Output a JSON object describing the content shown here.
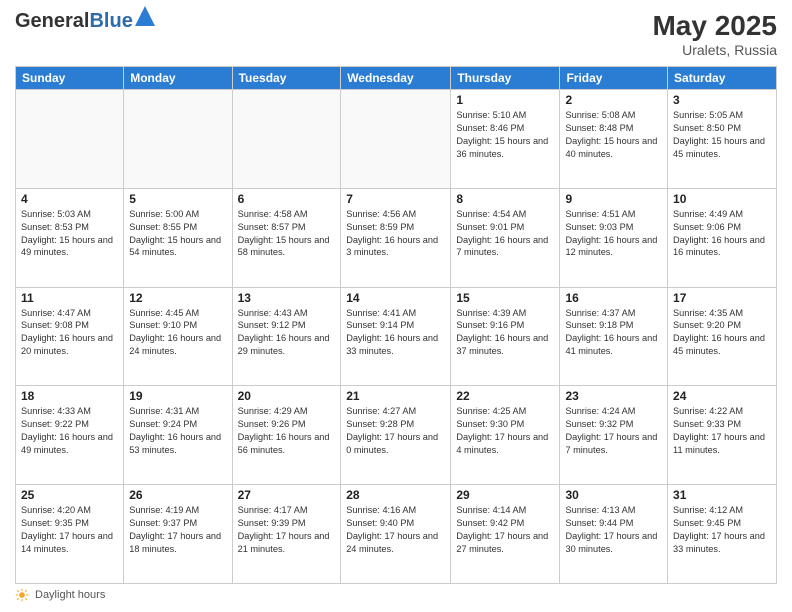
{
  "logo": {
    "general": "General",
    "blue": "Blue"
  },
  "title": {
    "month_year": "May 2025",
    "location": "Uralets, Russia"
  },
  "days_of_week": [
    "Sunday",
    "Monday",
    "Tuesday",
    "Wednesday",
    "Thursday",
    "Friday",
    "Saturday"
  ],
  "footer": {
    "label": "Daylight hours"
  },
  "weeks": [
    [
      {
        "day": "",
        "info": ""
      },
      {
        "day": "",
        "info": ""
      },
      {
        "day": "",
        "info": ""
      },
      {
        "day": "",
        "info": ""
      },
      {
        "day": "1",
        "info": "Sunrise: 5:10 AM\nSunset: 8:46 PM\nDaylight: 15 hours\nand 36 minutes."
      },
      {
        "day": "2",
        "info": "Sunrise: 5:08 AM\nSunset: 8:48 PM\nDaylight: 15 hours\nand 40 minutes."
      },
      {
        "day": "3",
        "info": "Sunrise: 5:05 AM\nSunset: 8:50 PM\nDaylight: 15 hours\nand 45 minutes."
      }
    ],
    [
      {
        "day": "4",
        "info": "Sunrise: 5:03 AM\nSunset: 8:53 PM\nDaylight: 15 hours\nand 49 minutes."
      },
      {
        "day": "5",
        "info": "Sunrise: 5:00 AM\nSunset: 8:55 PM\nDaylight: 15 hours\nand 54 minutes."
      },
      {
        "day": "6",
        "info": "Sunrise: 4:58 AM\nSunset: 8:57 PM\nDaylight: 15 hours\nand 58 minutes."
      },
      {
        "day": "7",
        "info": "Sunrise: 4:56 AM\nSunset: 8:59 PM\nDaylight: 16 hours\nand 3 minutes."
      },
      {
        "day": "8",
        "info": "Sunrise: 4:54 AM\nSunset: 9:01 PM\nDaylight: 16 hours\nand 7 minutes."
      },
      {
        "day": "9",
        "info": "Sunrise: 4:51 AM\nSunset: 9:03 PM\nDaylight: 16 hours\nand 12 minutes."
      },
      {
        "day": "10",
        "info": "Sunrise: 4:49 AM\nSunset: 9:06 PM\nDaylight: 16 hours\nand 16 minutes."
      }
    ],
    [
      {
        "day": "11",
        "info": "Sunrise: 4:47 AM\nSunset: 9:08 PM\nDaylight: 16 hours\nand 20 minutes."
      },
      {
        "day": "12",
        "info": "Sunrise: 4:45 AM\nSunset: 9:10 PM\nDaylight: 16 hours\nand 24 minutes."
      },
      {
        "day": "13",
        "info": "Sunrise: 4:43 AM\nSunset: 9:12 PM\nDaylight: 16 hours\nand 29 minutes."
      },
      {
        "day": "14",
        "info": "Sunrise: 4:41 AM\nSunset: 9:14 PM\nDaylight: 16 hours\nand 33 minutes."
      },
      {
        "day": "15",
        "info": "Sunrise: 4:39 AM\nSunset: 9:16 PM\nDaylight: 16 hours\nand 37 minutes."
      },
      {
        "day": "16",
        "info": "Sunrise: 4:37 AM\nSunset: 9:18 PM\nDaylight: 16 hours\nand 41 minutes."
      },
      {
        "day": "17",
        "info": "Sunrise: 4:35 AM\nSunset: 9:20 PM\nDaylight: 16 hours\nand 45 minutes."
      }
    ],
    [
      {
        "day": "18",
        "info": "Sunrise: 4:33 AM\nSunset: 9:22 PM\nDaylight: 16 hours\nand 49 minutes."
      },
      {
        "day": "19",
        "info": "Sunrise: 4:31 AM\nSunset: 9:24 PM\nDaylight: 16 hours\nand 53 minutes."
      },
      {
        "day": "20",
        "info": "Sunrise: 4:29 AM\nSunset: 9:26 PM\nDaylight: 16 hours\nand 56 minutes."
      },
      {
        "day": "21",
        "info": "Sunrise: 4:27 AM\nSunset: 9:28 PM\nDaylight: 17 hours\nand 0 minutes."
      },
      {
        "day": "22",
        "info": "Sunrise: 4:25 AM\nSunset: 9:30 PM\nDaylight: 17 hours\nand 4 minutes."
      },
      {
        "day": "23",
        "info": "Sunrise: 4:24 AM\nSunset: 9:32 PM\nDaylight: 17 hours\nand 7 minutes."
      },
      {
        "day": "24",
        "info": "Sunrise: 4:22 AM\nSunset: 9:33 PM\nDaylight: 17 hours\nand 11 minutes."
      }
    ],
    [
      {
        "day": "25",
        "info": "Sunrise: 4:20 AM\nSunset: 9:35 PM\nDaylight: 17 hours\nand 14 minutes."
      },
      {
        "day": "26",
        "info": "Sunrise: 4:19 AM\nSunset: 9:37 PM\nDaylight: 17 hours\nand 18 minutes."
      },
      {
        "day": "27",
        "info": "Sunrise: 4:17 AM\nSunset: 9:39 PM\nDaylight: 17 hours\nand 21 minutes."
      },
      {
        "day": "28",
        "info": "Sunrise: 4:16 AM\nSunset: 9:40 PM\nDaylight: 17 hours\nand 24 minutes."
      },
      {
        "day": "29",
        "info": "Sunrise: 4:14 AM\nSunset: 9:42 PM\nDaylight: 17 hours\nand 27 minutes."
      },
      {
        "day": "30",
        "info": "Sunrise: 4:13 AM\nSunset: 9:44 PM\nDaylight: 17 hours\nand 30 minutes."
      },
      {
        "day": "31",
        "info": "Sunrise: 4:12 AM\nSunset: 9:45 PM\nDaylight: 17 hours\nand 33 minutes."
      }
    ]
  ]
}
